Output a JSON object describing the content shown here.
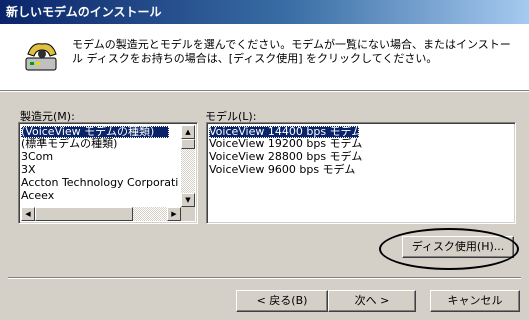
{
  "window": {
    "title": "新しいモデムのインストール"
  },
  "header": {
    "description": "モデムの製造元とモデルを選んでください。モデムが一覧にない場合、またはインストール ディスクをお持ちの場合は、[ディスク使用] をクリックしてください。",
    "icon": "modem-phone-icon"
  },
  "manufacturers": {
    "label": "製造元(M):",
    "items": [
      "(VoiceView モデムの種類)",
      "(標準モデムの種類)",
      "3Com",
      "3X",
      "Accton Technology Corporatic",
      "Aceex"
    ],
    "selected_index": 0
  },
  "models": {
    "label": "モデル(L):",
    "items": [
      "VoiceView 14400 bps モデム",
      "VoiceView 19200 bps モデム",
      "VoiceView 28800 bps モデム",
      "VoiceView 9600 bps モデム"
    ],
    "selected_index": 0
  },
  "buttons": {
    "disk": "ディスク使用(H)...",
    "back": "< 戻る(B)",
    "next": "次へ >",
    "cancel": "キャンセル"
  },
  "colors": {
    "selection": "#0a246a",
    "title_start": "#0a246a",
    "title_end": "#a6caf0"
  }
}
